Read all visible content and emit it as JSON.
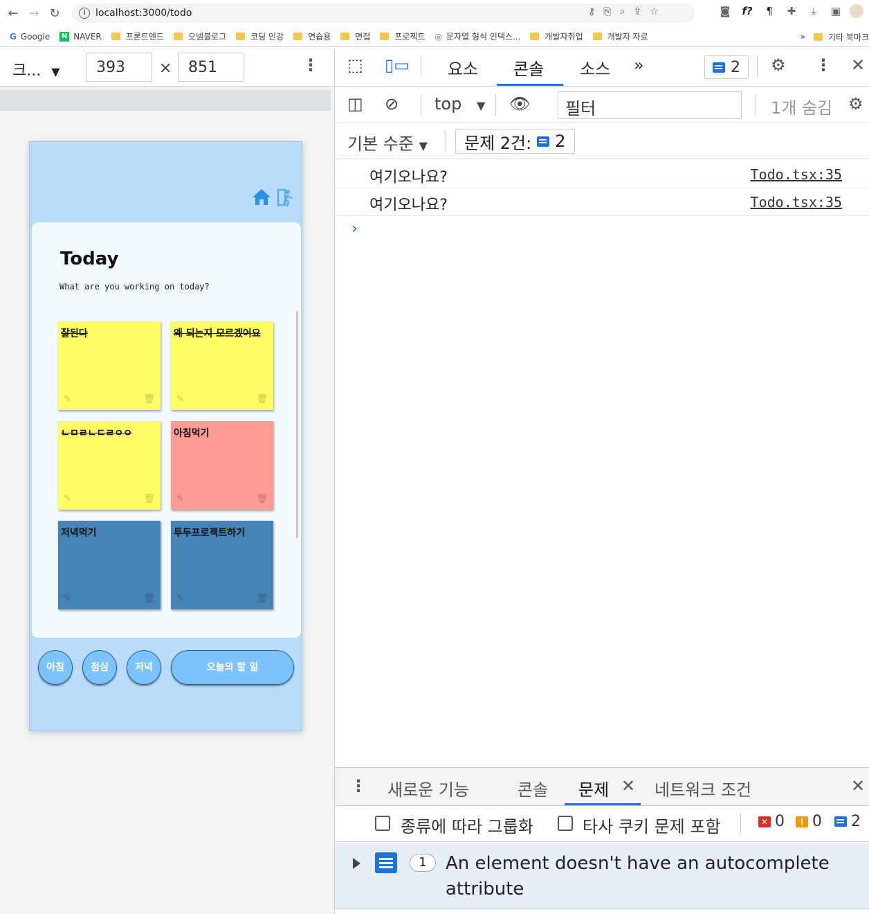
{
  "browser": {
    "url": "localhost:3000/todo",
    "bookmarks": [
      "Google",
      "NAVER",
      "프론트엔드",
      "오넴블로그",
      "코딩 인강",
      "연습용",
      "면접",
      "프로젝트",
      "문자열 형식 인덱스...",
      "개발자취업",
      "개발자 자료"
    ],
    "bookmarks_more": "»",
    "other_bookmarks": "기타 북마크"
  },
  "device_toolbar": {
    "device": "크...",
    "width": "393",
    "times": "×",
    "height": "851"
  },
  "app": {
    "title": "Today",
    "subtitle": "What are you working on today?",
    "notes": [
      {
        "text": "잘된다",
        "done": true,
        "color": "yellow"
      },
      {
        "text": "왜 되는지 모르겠어요",
        "done": true,
        "color": "yellow"
      },
      {
        "text": "ㄴㅁㄹㄴㄷㄹㅇㅇ",
        "done": true,
        "color": "yellow"
      },
      {
        "text": "아침먹기",
        "done": false,
        "color": "pink"
      },
      {
        "text": "저녁먹기",
        "done": false,
        "color": "blue"
      },
      {
        "text": "투두프로젝트하기",
        "done": false,
        "color": "blue"
      }
    ],
    "buttons": {
      "morning": "아침",
      "lunch": "점심",
      "dinner": "저녁",
      "today": "오늘의 할 일"
    }
  },
  "devtools": {
    "tabs": [
      "요소",
      "콘솔",
      "소스"
    ],
    "active_tab": "콘솔",
    "issue_badge_count": "2",
    "context": "top",
    "filter_placeholder": "필터",
    "hidden_count": "1개 숨김",
    "level": "기본 수준",
    "issues_chip_label": "문제 2건:",
    "issues_chip_count": "2",
    "logs": [
      {
        "message": "여기오나요?",
        "source": "Todo.tsx:35"
      },
      {
        "message": "여기오나요?",
        "source": "Todo.tsx:35"
      }
    ],
    "drawer_tabs": [
      "새로운 기능",
      "콘솔",
      "문제",
      "네트워크 조건"
    ],
    "drawer_active": "문제",
    "group_by_kind": "종류에 따라 그룹화",
    "include_third_party": "타사 쿠키 문제 포함",
    "error_count": "0",
    "warning_count": "0",
    "info_count": "2",
    "issue": {
      "count": "1",
      "text": "An element doesn't have an autocomplete attribute"
    }
  },
  "colors": {
    "note_yellow": "#ffff66",
    "note_pink": "#ff9a96",
    "note_blue": "#4682b4",
    "phone_bg": "#b8dcfa",
    "accent": "#1a73e8"
  }
}
